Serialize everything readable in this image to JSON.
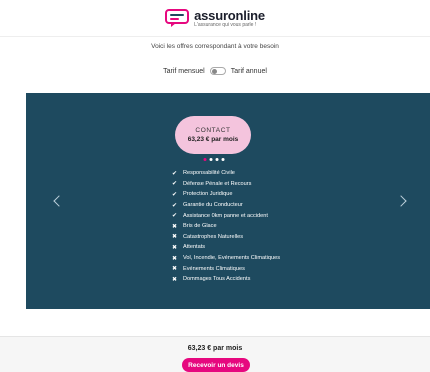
{
  "header": {
    "logo_name": "assuronline",
    "logo_tagline": "L'assurance qui vous parle !",
    "logo_colors": {
      "mark": "#e6087f",
      "text": "#1b1e2b"
    }
  },
  "subtitle": "Voici les offres correspondant à votre besoin",
  "billing_toggle": {
    "monthly_label": "Tarif mensuel",
    "annual_label": "Tarif annuel"
  },
  "carousel": {
    "panel_color": "#1e4a5f",
    "card": {
      "title": "CONTACT",
      "price": "63,23 € par mois",
      "pill_color": "#f4c4dd"
    },
    "dots": [
      true,
      false,
      false,
      false
    ],
    "features": [
      {
        "label": "Responsabilité Civile",
        "included": true
      },
      {
        "label": "Défense Pénale et Recours",
        "included": true
      },
      {
        "label": "Protection Juridique",
        "included": true
      },
      {
        "label": "Garantie du Conducteur",
        "included": true
      },
      {
        "label": "Assistance 0km panne et accident",
        "included": true
      },
      {
        "label": "Bris de Glace",
        "included": false
      },
      {
        "label": "Catastrophes Naturelles",
        "included": false
      },
      {
        "label": "Attentats",
        "included": false
      },
      {
        "label": "Vol, Incendie, Evénements Climatiques",
        "included": false
      },
      {
        "label": "Evénements Climatiques",
        "included": false
      },
      {
        "label": "Dommages Tous Accidents",
        "included": false
      }
    ]
  },
  "footer": {
    "price": "63,23 € par mois",
    "cta_label": "Recevoir un devis",
    "accent_color": "#e6087f"
  }
}
